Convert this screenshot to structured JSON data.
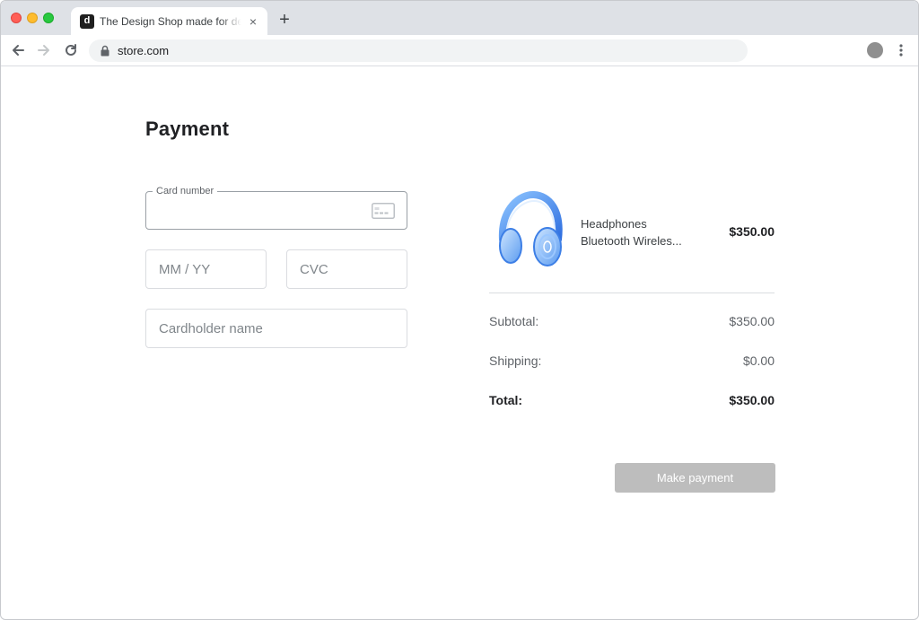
{
  "browser": {
    "tab_favicon_letter": "d",
    "tab_title": "The Design Shop made for designers",
    "tab_close": "×",
    "new_tab": "+",
    "url": "store.com"
  },
  "page": {
    "title": "Payment"
  },
  "form": {
    "card_number": {
      "label": "Card number",
      "value": "",
      "placeholder": ""
    },
    "expiry": {
      "placeholder": "MM / YY",
      "value": ""
    },
    "cvc": {
      "placeholder": "CVC",
      "value": ""
    },
    "cardholder": {
      "placeholder": "Cardholder name",
      "value": ""
    }
  },
  "order": {
    "item": {
      "name_line1": "Headphones",
      "name_line2": "Bluetooth Wireles...",
      "price": "$350.00",
      "icon": "headphones-image"
    },
    "subtotal_label": "Subtotal:",
    "subtotal_value": "$350.00",
    "shipping_label": "Shipping:",
    "shipping_value": "$0.00",
    "total_label": "Total:",
    "total_value": "$350.00"
  },
  "actions": {
    "pay_label": "Make payment"
  },
  "colors": {
    "button_disabled": "#bdbdbd",
    "accent": "#4a90e2"
  }
}
